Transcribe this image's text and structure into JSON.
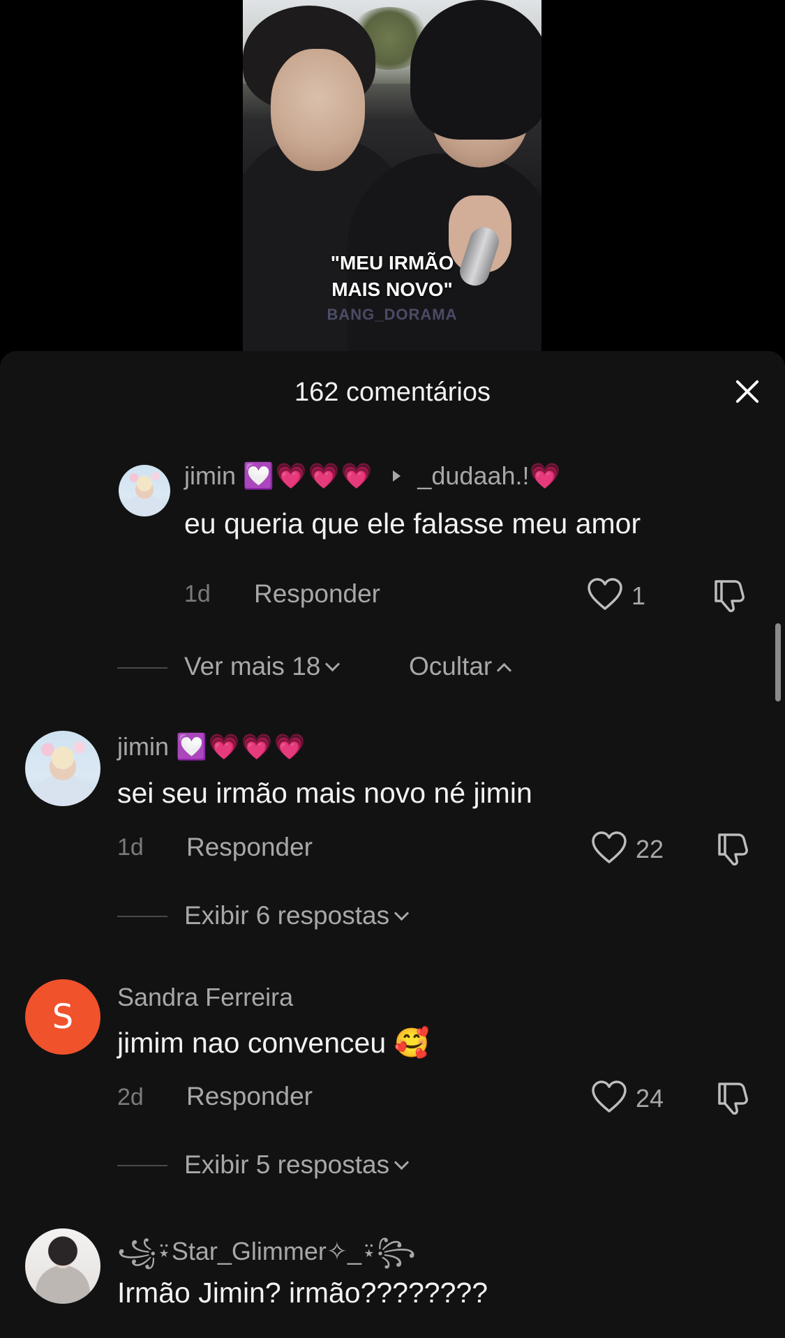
{
  "video": {
    "caption": "\"MEU IRMÃO\nMAIS NOVO\"",
    "watermark": "BANG_DORAMA"
  },
  "sheet": {
    "title": "162 comentários",
    "close_icon": "close-icon"
  },
  "comments": [
    {
      "username": "jimin",
      "user_emojis": "💟💗💗💗",
      "reply_to": "_dudaah.!💗",
      "text": "eu queria que ele falasse meu amor",
      "time": "1d",
      "reply_label": "Responder",
      "likes": "1"
    },
    {
      "username": "jimin",
      "user_emojis": "💟💗💗💗",
      "text": "sei seu irmão mais novo né jimin",
      "time": "1d",
      "reply_label": "Responder",
      "likes": "22",
      "thread_label": "Exibir 6 respostas"
    },
    {
      "username": "Sandra Ferreira",
      "avatar_letter": "S",
      "text": "jimim nao convenceu 🥰",
      "time": "2d",
      "reply_label": "Responder",
      "likes": "24",
      "thread_label": "Exibir 5 respostas"
    },
    {
      "username": "꧁⍣Star_Glimmer✧_⍣꧂",
      "text": "Irmão Jimin? irmão????????"
    }
  ],
  "thread_controls": {
    "more_label": "Ver mais 18",
    "hide_label": "Ocultar"
  },
  "colors": {
    "sheet_bg": "#121212",
    "avatar_s": "#f0522c",
    "muted_text": "#a8a8a8"
  }
}
